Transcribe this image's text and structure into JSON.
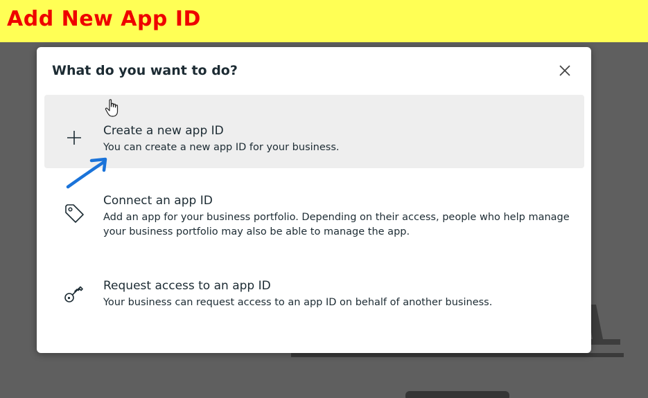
{
  "banner": {
    "title": "Add New App ID"
  },
  "modal": {
    "title": "What do you want to do?",
    "close_icon": "close-icon",
    "options": [
      {
        "icon": "plus-icon",
        "title": "Create a new app ID",
        "description": "You can create a new app ID for your business."
      },
      {
        "icon": "tag-icon",
        "title": "Connect an app ID",
        "description": "Add an app for your business portfolio. Depending on their access, people who help manage your business portfolio may also be able to manage the app."
      },
      {
        "icon": "key-icon",
        "title": "Request access to an app ID",
        "description": "Your business can request access to an app ID on behalf of another business."
      }
    ]
  },
  "colors": {
    "banner_bg": "#ffff55",
    "banner_text": "#ee0000",
    "annotation_arrow": "#1a73d9",
    "hover_bg": "#eeeeee"
  }
}
